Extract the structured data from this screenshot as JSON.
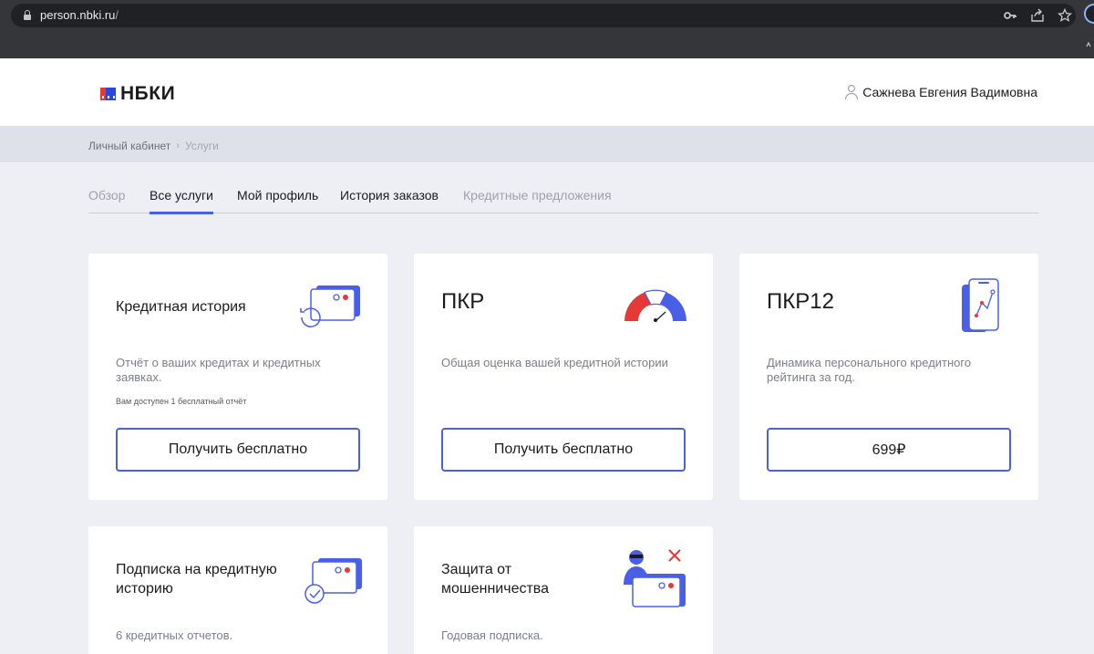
{
  "browser": {
    "url_host": "person.nbki.ru",
    "url_path": "/",
    "icons": [
      "lock-icon",
      "key-icon",
      "share-icon",
      "star-icon"
    ]
  },
  "header": {
    "logo_text": "НБКИ",
    "logo_colors": [
      "#ffffff",
      "#2b47d9",
      "#e53935"
    ],
    "user_name": "Сажнева Евгения Вадимовна"
  },
  "breadcrumbs": [
    {
      "label": "Личный кабинет"
    },
    {
      "label": "Услуги"
    }
  ],
  "tabs": [
    {
      "label": "Обзор",
      "state": "muted"
    },
    {
      "label": "Все услуги",
      "state": "active"
    },
    {
      "label": "Мой профиль",
      "state": "normal"
    },
    {
      "label": "История заказов",
      "state": "normal"
    },
    {
      "label": "Кредитные предложения",
      "state": "muted"
    }
  ],
  "cards": [
    {
      "title": "Кредитная история",
      "description": "Отчёт о ваших кредитах и кредитных заявках.",
      "note": "Вам доступен 1 бесплатный отчёт",
      "button": "Получить бесплатно",
      "icon": "credit-card-history-icon"
    },
    {
      "title": "ПКР",
      "description": "Общая оценка вашей кредитной истории",
      "button": "Получить бесплатно",
      "icon": "rating-gauge-icon"
    },
    {
      "title": "ПКР12",
      "description": "Динамика персонального кредитного рейтинга за год.",
      "button": "699₽",
      "icon": "phone-chart-icon"
    },
    {
      "title": "Подписка на кредитную историю",
      "description": "6 кредитных отчетов.",
      "icon": "credit-card-check-icon"
    },
    {
      "title": "Защита от мошенничества",
      "description": "Годовая подписка.",
      "icon": "fraud-protection-icon"
    }
  ],
  "colors": {
    "accent": "#4960e6",
    "danger": "#e53935",
    "page_bg": "#edeff5"
  }
}
